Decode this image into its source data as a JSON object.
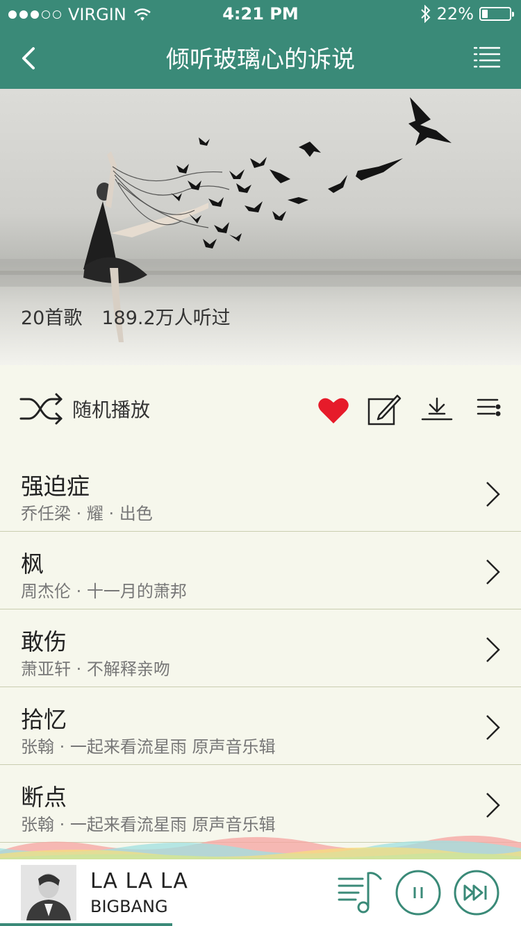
{
  "status": {
    "carrier": "VIRGIN",
    "time": "4:21 PM",
    "battery": "22%",
    "battery_level": 0.22
  },
  "header": {
    "title": "倾听玻璃心的诉说"
  },
  "cover": {
    "song_count": "20首歌",
    "listen_count": "189.2万人听过"
  },
  "actions": {
    "shuffle_label": "随机播放"
  },
  "songs": [
    {
      "title": "强迫症",
      "subtitle": "乔任梁 · 耀 · 出色"
    },
    {
      "title": "枫",
      "subtitle": "周杰伦 · 十一月的萧邦"
    },
    {
      "title": "敢伤",
      "subtitle": "萧亚轩 · 不解释亲吻"
    },
    {
      "title": "拾忆",
      "subtitle": "张翰 · 一起来看流星雨 原声音乐辑"
    },
    {
      "title": "断点",
      "subtitle": "张翰 · 一起来看流星雨 原声音乐辑"
    }
  ],
  "now_playing": {
    "title": "LA LA LA",
    "artist": "BIGBANG",
    "progress": 0.33
  },
  "colors": {
    "accent": "#3a8a78",
    "heart": "#e61b2a",
    "background": "#f6f7ec"
  }
}
